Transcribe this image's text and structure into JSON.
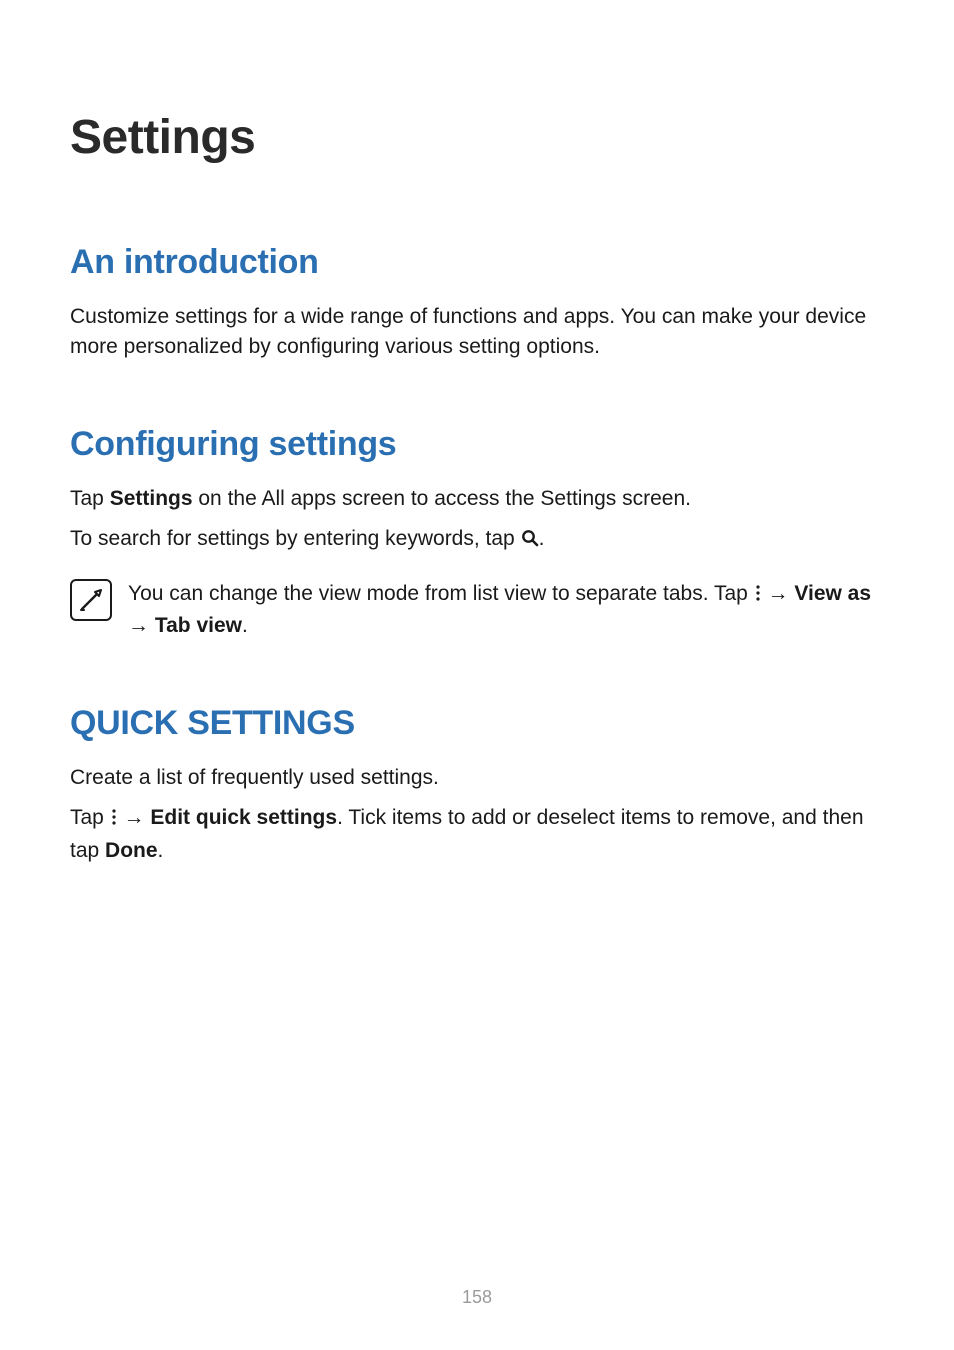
{
  "title": "Settings",
  "sections": {
    "intro": {
      "heading": "An introduction",
      "body": "Customize settings for a wide range of functions and apps. You can make your device more personalized by configuring various setting options."
    },
    "config": {
      "heading": "Configuring settings",
      "p1_pre": "Tap ",
      "p1_bold": "Settings",
      "p1_post": " on the All apps screen to access the Settings screen.",
      "p2_pre": "To search for settings by entering keywords, tap ",
      "p2_post": ".",
      "note_pre": "You can change the view mode from list view to separate tabs. Tap ",
      "note_arrow1": " → ",
      "note_bold1": "View as",
      "note_arrow2": " → ",
      "note_bold2": "Tab view",
      "note_post": "."
    },
    "quick": {
      "heading": "QUICK SETTINGS",
      "p1": "Create a list of frequently used settings.",
      "p2_pre": "Tap ",
      "p2_arrow": " → ",
      "p2_bold": "Edit quick settings",
      "p2_mid": ". Tick items to add or deselect items to remove, and then tap ",
      "p2_bold2": "Done",
      "p2_post": "."
    }
  },
  "page_number": "158"
}
